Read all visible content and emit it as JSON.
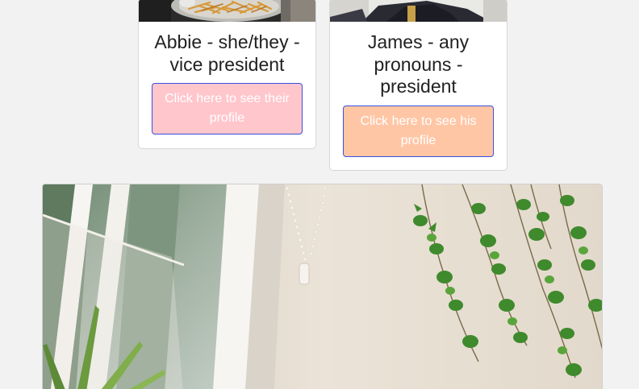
{
  "team_cards": [
    {
      "title": "Abbie - she/they - vice president",
      "button_label": "Click here to see their profile"
    },
    {
      "title": "James - any pronouns - president",
      "button_label": "Click here to see his profile"
    }
  ],
  "colors": {
    "abbie_button": "#ffc6cc",
    "james_button": "#ffc6a6",
    "button_border": "#3b4fe0"
  }
}
